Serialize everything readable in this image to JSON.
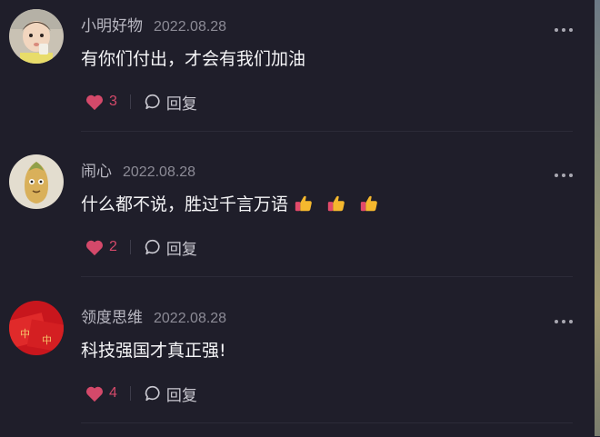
{
  "comments": [
    {
      "username": "小明好物",
      "date": "2022.08.28",
      "text": "有你们付出，才会有我们加油",
      "likes": "3",
      "reply_label": "回复",
      "avatar": "child-photo-avatar",
      "emojis": []
    },
    {
      "username": "闹心",
      "date": "2022.08.28",
      "text": "什么都不说，胜过千言万语",
      "likes": "2",
      "reply_label": "回复",
      "avatar": "cartoon-corn-avatar",
      "emojis": [
        "thumbs-up-icon",
        "thumbs-up-icon",
        "thumbs-up-icon"
      ]
    },
    {
      "username": "领度思维",
      "date": "2022.08.28",
      "text": "科技强国才真正强!",
      "likes": "4",
      "reply_label": "回复",
      "avatar": "red-envelope-avatar",
      "emojis": []
    }
  ],
  "colors": {
    "background": "#1f1e2a",
    "like_heart": "#d4496a",
    "username": "#b9b8c2",
    "text": "#f4f4f6"
  }
}
